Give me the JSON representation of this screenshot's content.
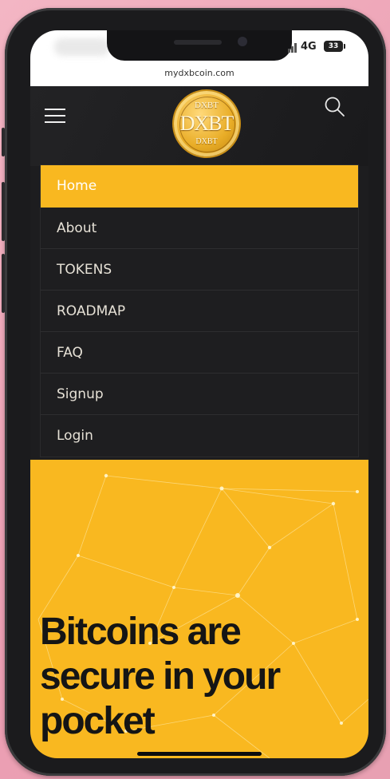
{
  "status_bar": {
    "network": "4G",
    "battery": "33"
  },
  "browser": {
    "url": "mydxbcoin.com"
  },
  "header": {
    "menu_icon": "hamburger-icon",
    "search_icon": "search-icon",
    "logo": {
      "top_text": "DXBT",
      "main_text": "DXBT",
      "bottom_text": "DXBT"
    }
  },
  "nav": {
    "items": [
      {
        "label": "Home",
        "active": true
      },
      {
        "label": "About",
        "active": false
      },
      {
        "label": "TOKENS",
        "active": false
      },
      {
        "label": "ROADMAP",
        "active": false
      },
      {
        "label": "FAQ",
        "active": false
      },
      {
        "label": "Signup",
        "active": false
      },
      {
        "label": "Login",
        "active": false
      }
    ]
  },
  "hero": {
    "title_line1": "Bitcoins are",
    "title_line2": "secure in your",
    "title_line3": "pocket"
  },
  "colors": {
    "accent": "#f9b820",
    "header_bg": "#1d1d1f",
    "menu_text": "#e6e1d6",
    "hero_text": "#151515"
  }
}
